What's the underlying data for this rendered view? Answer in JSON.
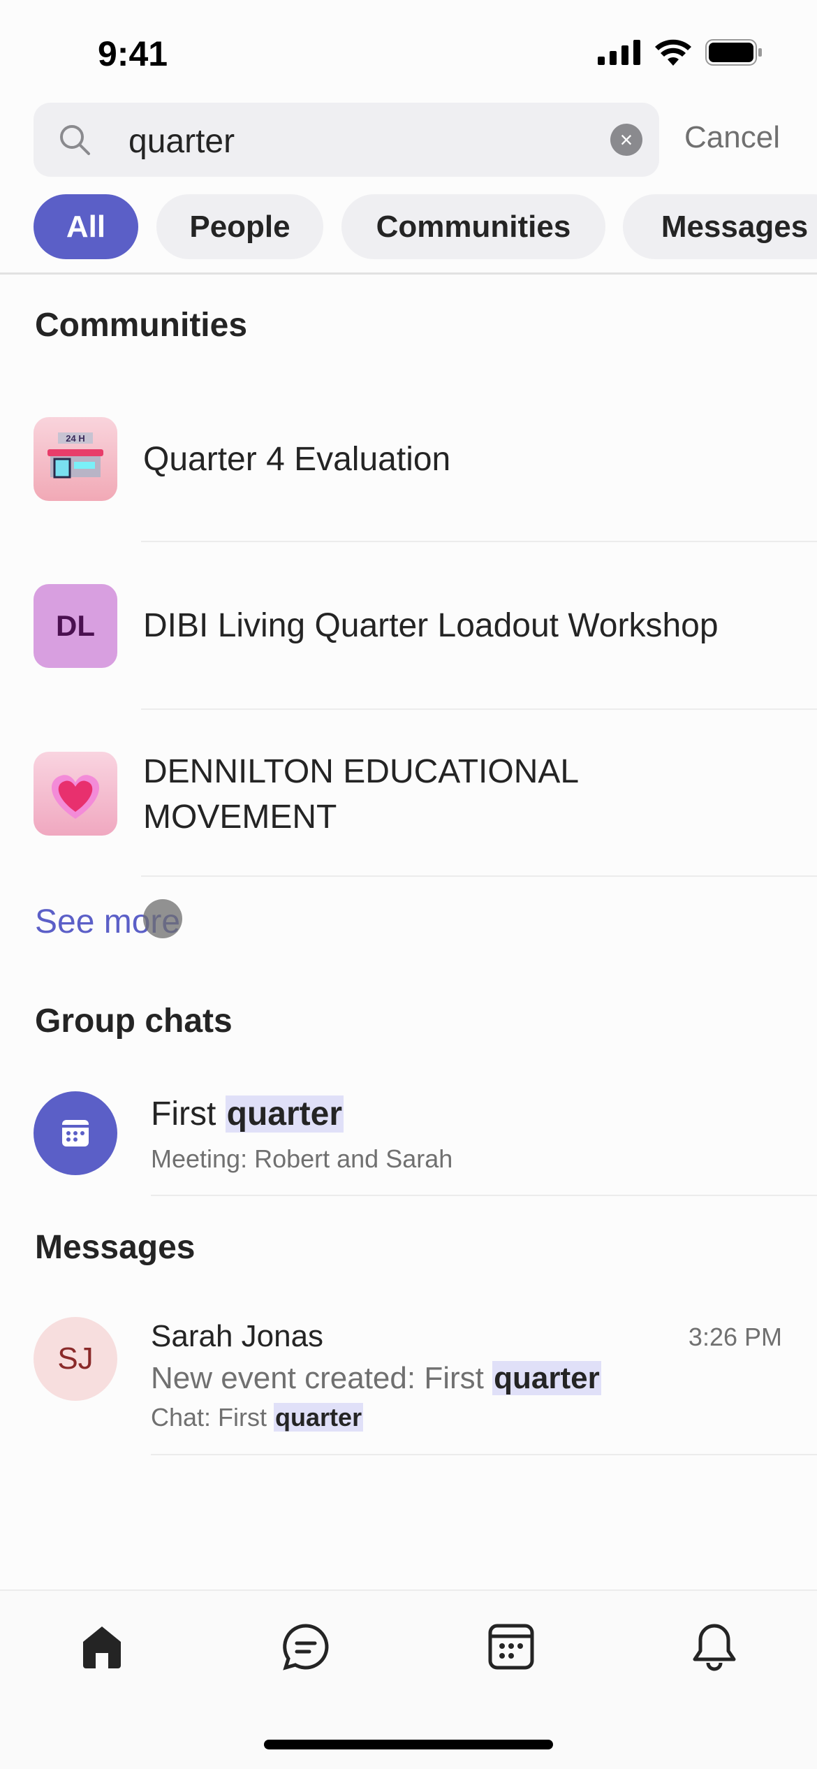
{
  "status_bar": {
    "time": "9:41"
  },
  "search": {
    "query": "quarter",
    "cancel_label": "Cancel"
  },
  "filters": [
    {
      "label": "All",
      "active": true
    },
    {
      "label": "People"
    },
    {
      "label": "Communities"
    },
    {
      "label": "Messages"
    }
  ],
  "communities": {
    "header": "Communities",
    "items": [
      {
        "name": "Quarter 4 Evaluation",
        "icon": "store-24h-icon"
      },
      {
        "name": "DIBI Living Quarter Loadout Workshop",
        "initials": "DL"
      },
      {
        "name_line1": "DENNILTON EDUCATIONAL",
        "name_line2": "MOVEMENT",
        "icon": "heart-icon"
      }
    ],
    "see_more": "See more"
  },
  "group_chats": {
    "header": "Group chats",
    "items": [
      {
        "title_prefix": "First",
        "title_match": "quarter",
        "subtitle": "Meeting: Robert and Sarah",
        "icon": "calendar-icon"
      }
    ]
  },
  "messages": {
    "header": "Messages",
    "items": [
      {
        "initials": "SJ",
        "sender": "Sarah Jonas",
        "time": "3:26 PM",
        "preview_prefix": "New event created: First",
        "preview_match": "quarter",
        "chat_prefix": "Chat: First",
        "chat_match": "quarter"
      }
    ]
  },
  "bottom_nav": [
    {
      "icon": "home-icon",
      "active": true
    },
    {
      "icon": "chat-icon"
    },
    {
      "icon": "calendar-icon"
    },
    {
      "icon": "bell-icon"
    }
  ],
  "colors": {
    "accent": "#5b5fc7",
    "highlight": "#e0e0f8",
    "avatar_dl": "#d89fe0",
    "avatar_sj": "#f7dede"
  }
}
